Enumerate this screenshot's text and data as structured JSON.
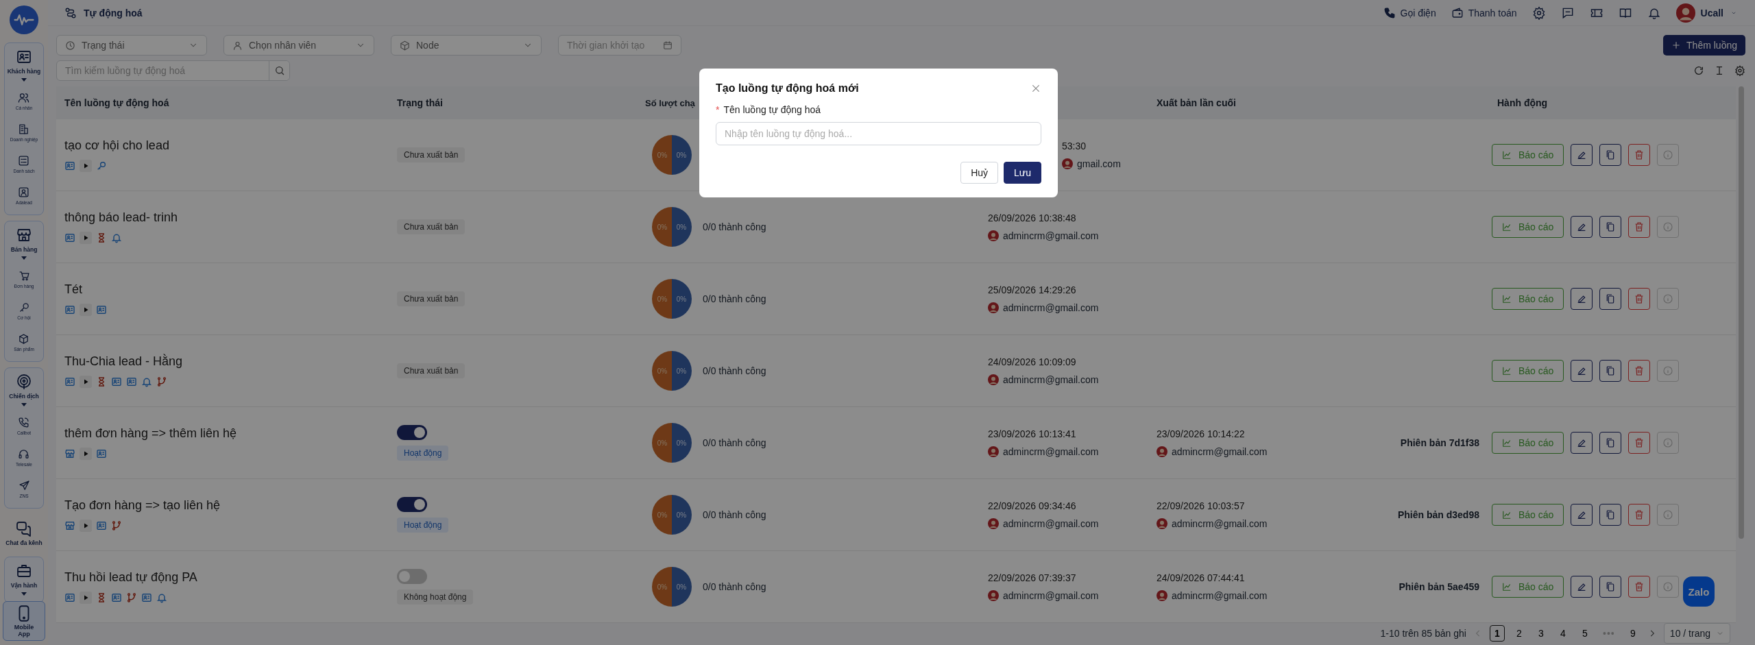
{
  "sidebar": {
    "groups": [
      {
        "kind": "group",
        "label": "Khách hàng",
        "items": [
          {
            "label": "Cá nhân"
          },
          {
            "label": "Doanh nghiệp"
          },
          {
            "label": "Danh sách"
          },
          {
            "label": "Adalead"
          }
        ]
      },
      {
        "kind": "group",
        "label": "Bán hàng",
        "items": [
          {
            "label": "Đơn hàng"
          },
          {
            "label": "Cơ hội"
          },
          {
            "label": "Sản phẩm"
          }
        ]
      },
      {
        "kind": "group",
        "label": "Chiến dịch",
        "items": [
          {
            "label": "Callbot"
          },
          {
            "label": "Telesale"
          },
          {
            "label": "ZNS"
          }
        ]
      },
      {
        "kind": "link",
        "label": "Chat đa kênh"
      },
      {
        "kind": "group",
        "label": "Vận hành"
      }
    ],
    "mobile_app": "Mobile App"
  },
  "header": {
    "title": "Tự động hoá",
    "actions": [
      "Gọi điện",
      "Thanh toán"
    ],
    "user": "Ucall"
  },
  "filters": [
    {
      "kind": "select",
      "placeholder": "Trạng thái"
    },
    {
      "kind": "select",
      "placeholder": "Chọn nhân viên"
    },
    {
      "kind": "select",
      "placeholder": "Node"
    },
    {
      "kind": "date",
      "placeholder": "Thời gian khởi tạo"
    }
  ],
  "search": {
    "placeholder": "Tìm kiếm luồng tự động hoá"
  },
  "add_button": "Thêm luồng",
  "table": {
    "columns": {
      "name": "Tên luồng tự động hoá",
      "status": "Trạng thái",
      "runs": "Số lượt chạ",
      "published": "Xuất bản lần cuối",
      "actions": "Hành động"
    },
    "rows": [
      {
        "name": "tạo cơ hội cho lead",
        "nodes": [
          {
            "kind": "contact"
          },
          {
            "kind": "play"
          },
          {
            "kind": "key"
          }
        ],
        "status": {
          "kind": "tag",
          "label": "Chưa xuất bản"
        },
        "pie_labels": [
          "0%",
          "0%"
        ],
        "created": {
          "time": "53:30",
          "by": "gmail.com",
          "cut": true
        },
        "report": "Báo cáo"
      },
      {
        "name": "thông báo lead- trinh",
        "nodes": [
          {
            "kind": "contact"
          },
          {
            "kind": "play"
          },
          {
            "kind": "hourglass"
          },
          {
            "kind": "bell"
          }
        ],
        "status": {
          "kind": "tag",
          "label": "Chưa xuất bản"
        },
        "pie_labels": [
          "0%",
          "0%"
        ],
        "runs": "0/0 thành công",
        "created": {
          "time": "26/09/2026 10:38:48",
          "by": "admincrm@gmail.com",
          "cut": false
        },
        "report": "Báo cáo"
      },
      {
        "name": "Tét",
        "nodes": [
          {
            "kind": "contact"
          },
          {
            "kind": "play"
          },
          {
            "kind": "contact"
          }
        ],
        "status": {
          "kind": "tag",
          "label": "Chưa xuất bản"
        },
        "pie_labels": [
          "0%",
          "0%"
        ],
        "runs": "0/0 thành công",
        "created": {
          "time": "25/09/2026 14:29:26",
          "by": "admincrm@gmail.com",
          "cut": false
        },
        "report": "Báo cáo"
      },
      {
        "name": "Thu-Chia lead - Hằng",
        "nodes": [
          {
            "kind": "contact"
          },
          {
            "kind": "play"
          },
          {
            "kind": "hourglass"
          },
          {
            "kind": "contact"
          },
          {
            "kind": "contact"
          },
          {
            "kind": "bell"
          },
          {
            "kind": "branch"
          }
        ],
        "status": {
          "kind": "tag",
          "label": "Chưa xuất bản"
        },
        "pie_labels": [
          "0%",
          "0%"
        ],
        "runs": "0/0 thành công",
        "created": {
          "time": "24/09/2026 10:09:09",
          "by": "admincrm@gmail.com",
          "cut": false
        },
        "report": "Báo cáo"
      },
      {
        "name": "thêm đơn hàng => thêm liên hệ",
        "nodes": [
          {
            "kind": "store"
          },
          {
            "kind": "play"
          },
          {
            "kind": "contact"
          }
        ],
        "status": {
          "kind": "toggle",
          "on": true,
          "label": "Hoạt động"
        },
        "pie_labels": [
          "0%",
          "0%"
        ],
        "runs": "0/0 thành công",
        "created": {
          "time": "23/09/2026 10:13:41",
          "by": "admincrm@gmail.com",
          "cut": false
        },
        "published": {
          "time": "23/09/2026 10:14:22",
          "by": "admincrm@gmail.com"
        },
        "version": "Phiên bản 7d1f38",
        "report": "Báo cáo"
      },
      {
        "name": "Tạo đơn hàng => tạo liên hệ",
        "nodes": [
          {
            "kind": "store"
          },
          {
            "kind": "play"
          },
          {
            "kind": "contact"
          },
          {
            "kind": "branch"
          }
        ],
        "status": {
          "kind": "toggle",
          "on": true,
          "label": "Hoạt động"
        },
        "pie_labels": [
          "0%",
          "0%"
        ],
        "runs": "0/0 thành công",
        "created": {
          "time": "22/09/2026 09:34:46",
          "by": "admincrm@gmail.com",
          "cut": false
        },
        "published": {
          "time": "22/09/2026 10:03:57",
          "by": "admincrm@gmail.com"
        },
        "version": "Phiên bản d3ed98",
        "report": "Báo cáo"
      },
      {
        "name": "Thu hồi lead tự động PA",
        "nodes": [
          {
            "kind": "contact"
          },
          {
            "kind": "play"
          },
          {
            "kind": "hourglass"
          },
          {
            "kind": "contact"
          },
          {
            "kind": "branch"
          },
          {
            "kind": "contact"
          },
          {
            "kind": "bell"
          }
        ],
        "status": {
          "kind": "toggle",
          "on": false,
          "label": "Không hoạt động"
        },
        "pie_labels": [
          "0%",
          "0%"
        ],
        "runs": "0/0 thành công",
        "created": {
          "time": "22/09/2026 07:39:37",
          "by": "admincrm@gmail.com",
          "cut": false
        },
        "published": {
          "time": "24/09/2026 07:44:41",
          "by": "admincrm@gmail.com"
        },
        "version": "Phiên bản 5ae459",
        "report": "Báo cáo"
      }
    ]
  },
  "pagination": {
    "summary": "1-10 trên 85 bản ghi",
    "pages": [
      {
        "kind": "page",
        "label": "1",
        "selected": true
      },
      {
        "kind": "page",
        "label": "2",
        "selected": false
      },
      {
        "kind": "page",
        "label": "3",
        "selected": false
      },
      {
        "kind": "page",
        "label": "4",
        "selected": false
      },
      {
        "kind": "page",
        "label": "5",
        "selected": false
      },
      {
        "kind": "ellipsis",
        "label": "•••",
        "selected": false
      },
      {
        "kind": "page",
        "label": "9",
        "selected": false
      }
    ],
    "page_size": "10 / trang"
  },
  "zalo": "Zalo",
  "modal": {
    "title": "Tạo luồng tự động hoá mới",
    "field_label": "Tên luồng tự động hoá",
    "required_mark": "*",
    "placeholder": "Nhập tên luồng tự động hoá...",
    "buttons": [
      {
        "kind": "default",
        "label": "Huỷ"
      },
      {
        "kind": "primary",
        "label": "Lưu"
      }
    ]
  }
}
